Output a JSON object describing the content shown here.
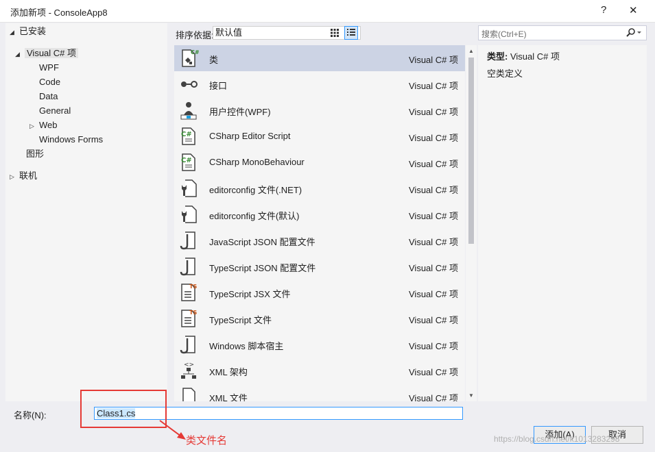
{
  "window": {
    "title": "添加新项 - ConsoleApp8",
    "help_label": "?",
    "close_label": "✕"
  },
  "tree": {
    "installed": "已安装",
    "visual_csharp": "Visual C# 项",
    "children": [
      "WPF",
      "Code",
      "Data",
      "General",
      "Web",
      "Windows Forms"
    ],
    "graphics": "图形",
    "online": "联机"
  },
  "sort": {
    "label": "排序依据:",
    "value": "默认值"
  },
  "search": {
    "placeholder": "搜索(Ctrl+E)"
  },
  "items": [
    {
      "name": "类",
      "kind": "Visual C# 项",
      "icon": "class-icon"
    },
    {
      "name": "接口",
      "kind": "Visual C# 项",
      "icon": "interface-icon"
    },
    {
      "name": "用户控件(WPF)",
      "kind": "Visual C# 项",
      "icon": "user-control-icon"
    },
    {
      "name": "CSharp Editor Script",
      "kind": "Visual C# 项",
      "icon": "csharp-file-icon"
    },
    {
      "name": "CSharp MonoBehaviour",
      "kind": "Visual C# 项",
      "icon": "csharp-file-icon"
    },
    {
      "name": "editorconfig 文件(.NET)",
      "kind": "Visual C# 项",
      "icon": "config-file-icon"
    },
    {
      "name": "editorconfig 文件(默认)",
      "kind": "Visual C# 项",
      "icon": "config-file-icon"
    },
    {
      "name": "JavaScript JSON 配置文件",
      "kind": "Visual C# 项",
      "icon": "json-file-icon"
    },
    {
      "name": "TypeScript JSON 配置文件",
      "kind": "Visual C# 项",
      "icon": "json-file-icon"
    },
    {
      "name": "TypeScript JSX 文件",
      "kind": "Visual C# 项",
      "icon": "ts-file-icon"
    },
    {
      "name": "TypeScript 文件",
      "kind": "Visual C# 项",
      "icon": "ts-file-icon"
    },
    {
      "name": "Windows 脚本宿主",
      "kind": "Visual C# 项",
      "icon": "script-host-icon"
    },
    {
      "name": "XML 架构",
      "kind": "Visual C# 项",
      "icon": "xml-schema-icon"
    },
    {
      "name": "XML 文件",
      "kind": "Visual C# 项",
      "icon": "xml-file-icon"
    }
  ],
  "description": {
    "type_label": "类型:",
    "type_value": "Visual C# 项",
    "text": "空类定义"
  },
  "name_field": {
    "label": "名称(N):",
    "value": "Class1.cs"
  },
  "buttons": {
    "add": "添加(A)",
    "cancel": "取消"
  },
  "annotation": {
    "text": "类文件名",
    "color": "#e53935"
  },
  "watermark": "https://blog.csdn.net/k1013283298",
  "colors": {
    "selection": "#ccd3e4",
    "accent": "#3399ff",
    "annotation": "#e53935"
  }
}
